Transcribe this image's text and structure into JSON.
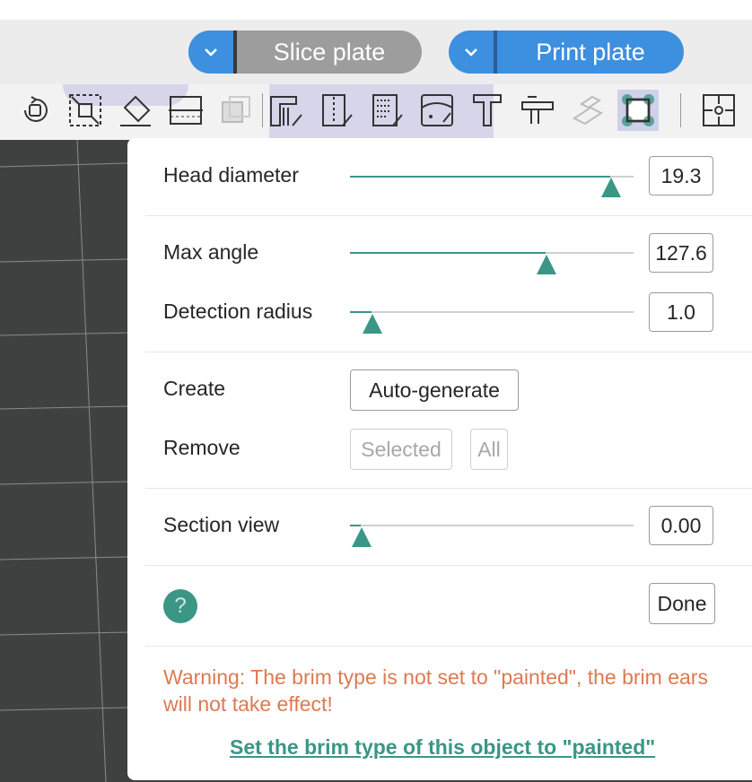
{
  "header": {
    "slice_button": {
      "label": "Slice plate",
      "dropdown_icon": "chevron-down-icon"
    },
    "print_button": {
      "label": "Print plate",
      "dropdown_icon": "chevron-down-icon"
    }
  },
  "toolbar": {
    "tools": [
      "rotate-icon",
      "scale-icon",
      "lay-on-face-icon",
      "cut-icon",
      "boolean-icon",
      "support-painting-icon",
      "seam-painting-icon",
      "fuzzy-skin-icon",
      "color-painting-icon",
      "text-icon",
      "measure-icon",
      "assembly-icon",
      "brim-ears-icon",
      "split-icon"
    ],
    "selected_tool": "brim-ears-icon"
  },
  "panel": {
    "head_diameter": {
      "label": "Head diameter",
      "value": "19.3",
      "slider_fraction": 0.92
    },
    "max_angle": {
      "label": "Max angle",
      "value": "127.6",
      "slider_fraction": 0.7
    },
    "detection_radius": {
      "label": "Detection radius",
      "value": "1.0",
      "slider_fraction": 0.08
    },
    "create": {
      "label": "Create",
      "button": "Auto-generate"
    },
    "remove": {
      "label": "Remove",
      "selected_button": "Selected",
      "all_button": "All"
    },
    "section_view": {
      "label": "Section view",
      "value": "0.00",
      "slider_fraction": 0.04
    },
    "help_icon": "?",
    "done_button": "Done",
    "warning": "Warning: The brim type is not set to \"painted\", the brim ears will not take effect!",
    "link": "Set the brim type of this object to \"painted\""
  },
  "colors": {
    "accent": "#3b9686",
    "button_blue": "#3d8fe0",
    "button_gray": "#9d9d9d",
    "warning": "#dc7a52",
    "viewport": "#3f4040"
  }
}
